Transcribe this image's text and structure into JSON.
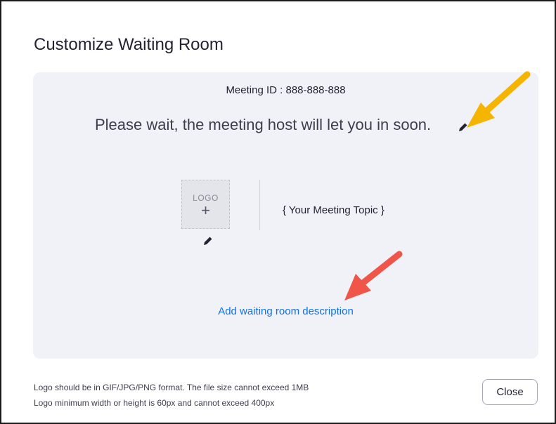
{
  "dialog": {
    "title": "Customize Waiting Room",
    "close_label": "Close",
    "footer_notes": [
      "Logo should be in GIF/JPG/PNG format. The file size cannot exceed 1MB",
      "Logo minimum width or height is 60px and cannot exceed 400px"
    ]
  },
  "preview": {
    "meeting_id": "Meeting ID : 888-888-888",
    "wait_message": "Please wait, the meeting host will let you in soon.",
    "logo_label": "LOGO",
    "logo_plus": "+",
    "meeting_topic": "{ Your Meeting Topic }",
    "add_description_label": "Add waiting room description"
  },
  "colors": {
    "link": "#0e71eb",
    "preview_bg": "#f1f2f7",
    "arrow_yellow": "#f5b400",
    "arrow_red": "#f0554a"
  },
  "icons": [
    "pencil-icon",
    "plus-icon",
    "arrow-annotation"
  ]
}
